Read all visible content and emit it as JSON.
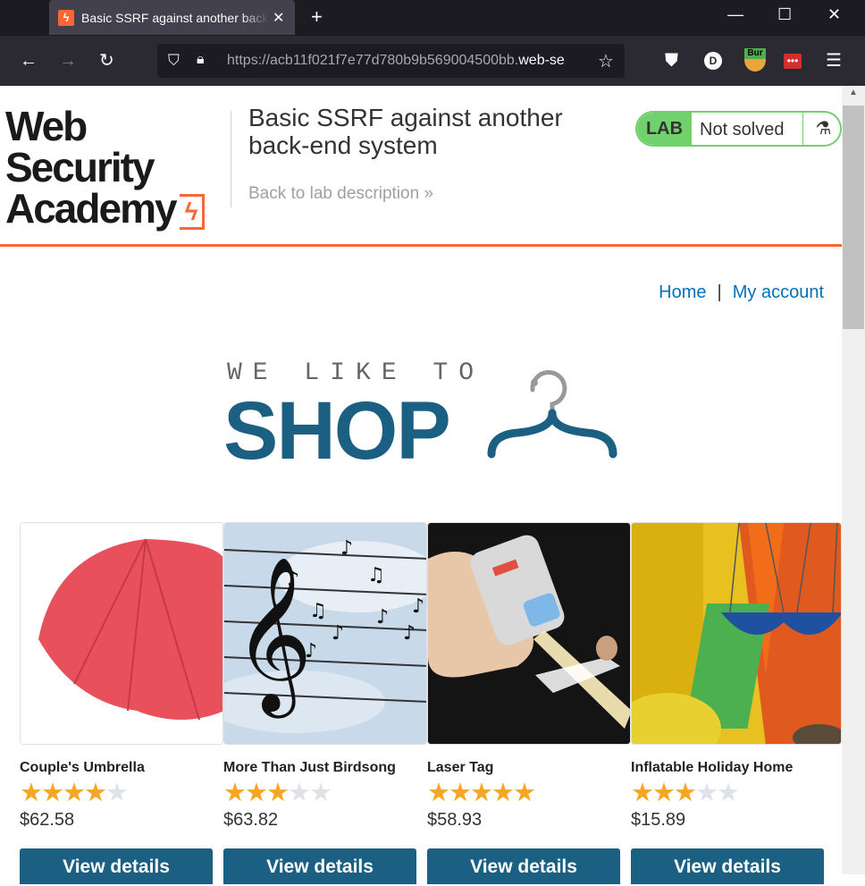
{
  "browser": {
    "tab_title": "Basic SSRF against another back-end system",
    "url_prefix": "https://acb11f021f7e77d780b9b569004500bb.",
    "url_domain": "web-se",
    "new_tab": "+",
    "extension_badge": "Bur",
    "account_initial": "D"
  },
  "header": {
    "logo_line1": "Web Security",
    "logo_line2": "Academy",
    "lab_title": "Basic SSRF against another back-end system",
    "back_link": "Back to lab description »",
    "badge_label": "LAB",
    "badge_status": "Not solved",
    "colors": {
      "accent": "#ff6633",
      "badge_green": "#70d16d"
    }
  },
  "nav": {
    "home": "Home",
    "separator": "|",
    "account": "My account"
  },
  "banner": {
    "tagline": "WE LIKE TO",
    "title": "SHOP",
    "color": "#1b5f82"
  },
  "products": [
    {
      "name": "Couple's Umbrella",
      "rating": 4,
      "price": "$62.58",
      "button": "View details"
    },
    {
      "name": "More Than Just Birdsong",
      "rating": 3,
      "price": "$63.82",
      "button": "View details"
    },
    {
      "name": "Laser Tag",
      "rating": 5,
      "price": "$58.93",
      "button": "View details"
    },
    {
      "name": "Inflatable Holiday Home",
      "rating": 3,
      "price": "$15.89",
      "button": "View details"
    }
  ]
}
